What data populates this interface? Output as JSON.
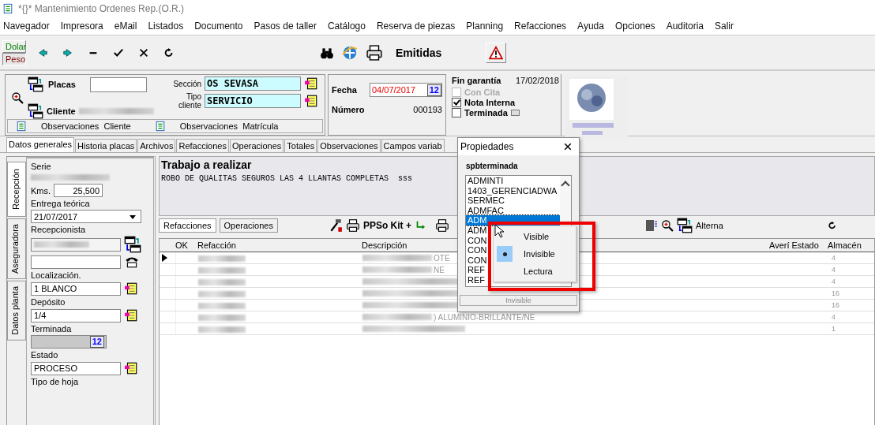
{
  "window": {
    "title": "*{}* Mantenimiento Ordenes Rep.(O.R.)"
  },
  "menu": [
    "Navegador",
    "Impresora",
    "eMail",
    "Listados",
    "Documento",
    "Pasos de taller",
    "Catálogo",
    "Reserva de piezas",
    "Planning",
    "Refacciones",
    "Ayuda",
    "Opciones",
    "Auditoria",
    "Salir"
  ],
  "toolbar": {
    "currency": [
      {
        "label": "Dolar",
        "selected": false,
        "color": "#008000"
      },
      {
        "label": "Peso",
        "selected": true,
        "color": "#800000"
      }
    ],
    "view_label": "Emitidas"
  },
  "vehicle": {
    "plates_label": "Placas",
    "section_label": "Sección",
    "section_value": "OS SEVASA",
    "client_type_label": "Tipo cliente",
    "client_type_value": "SERVICIO",
    "client_label": "Cliente",
    "notes_buttons": [
      "Observaciones  Cliente",
      "Observaciones  Matrícula"
    ]
  },
  "order": {
    "date_label": "Fecha",
    "date_value": "04/07/2017",
    "calendar_label": "12",
    "number_label": "Número",
    "number_value": "000193"
  },
  "warranty": {
    "label": "Fin garantía",
    "date": "17/02/2018",
    "checks": [
      {
        "label": "Con Cita",
        "checked": false,
        "disabled": true
      },
      {
        "label": "Nota Interna",
        "checked": true,
        "disabled": false
      },
      {
        "label": "Terminada",
        "checked": false,
        "disabled": false
      }
    ]
  },
  "tabs": [
    {
      "label": "Datos generales",
      "selected": true
    },
    {
      "label": "Historia placas",
      "selected": false
    },
    {
      "label": "Archivos",
      "selected": false
    },
    {
      "label": "Refacciones",
      "selected": false
    },
    {
      "label": "Operaciones",
      "selected": false
    },
    {
      "label": "Totales",
      "selected": false
    },
    {
      "label": "Observaciones",
      "selected": false
    },
    {
      "label": "Campos variab",
      "selected": false
    }
  ],
  "side_tabs": [
    {
      "label": "Recepción",
      "selected": true
    },
    {
      "label": "Aseguradora",
      "selected": false
    },
    {
      "label": "Datos planta",
      "selected": false
    }
  ],
  "reception_fields": [
    {
      "label": "Serie",
      "kind": "blurred"
    },
    {
      "label": "Kms.",
      "kind": "inline",
      "value": "25,500"
    },
    {
      "label": "Entrega teórica",
      "kind": "dropdown",
      "value": "21/07/2017"
    },
    {
      "label": "Recepcionista",
      "kind": "person"
    },
    {
      "label": "Localización.",
      "kind": "lookup",
      "value": "1 BLANCO"
    },
    {
      "label": "Depósito",
      "kind": "lookup",
      "value": "1/4"
    },
    {
      "label": "Terminada",
      "kind": "date",
      "calendar_label": "12"
    },
    {
      "label": "Estado",
      "kind": "lookup",
      "value": "PROCESO"
    },
    {
      "label": "Tipo de hoja",
      "kind": "label"
    }
  ],
  "work": {
    "title": "Trabajo a realizar",
    "text": "ROBO DE QUALITAS SEGUROS LAS 4 LLANTAS COMPLETAS  sss"
  },
  "parts": {
    "tabs": [
      {
        "label": "Refacciones",
        "selected": true
      },
      {
        "label": "Operaciones",
        "selected": false
      }
    ],
    "kit_label": "PPSo Kit +",
    "alterna_label": "Alterna",
    "columns": [
      "OK",
      "Refacción",
      "Descripción",
      "Averí Estado",
      "Almacén"
    ],
    "rows": [
      {
        "current": true,
        "description": "OTE",
        "almacen": "4"
      },
      {
        "current": false,
        "description": "NE",
        "almacen": "4"
      },
      {
        "current": false,
        "almacen": "4"
      },
      {
        "current": false,
        "almacen": "16"
      },
      {
        "current": false,
        "almacen": "16"
      },
      {
        "current": false,
        "description": ") ALUMINIO-BRILLANTE/NE",
        "almacen": "4"
      },
      {
        "current": false,
        "almacen": "1"
      }
    ]
  },
  "properties_dialog": {
    "title": "Propiedades",
    "field": "spbterminada",
    "users": [
      {
        "label": "ADMINTI",
        "selected": false
      },
      {
        "label": "1403_GERENCIADWA",
        "selected": false
      },
      {
        "label": "SERMEC",
        "selected": false
      },
      {
        "label": "ADMFAC",
        "selected": false
      },
      {
        "label": "ADM",
        "selected": true
      },
      {
        "label": "ADM",
        "selected": false
      },
      {
        "label": "CON",
        "selected": false
      },
      {
        "label": "CON",
        "selected": false
      },
      {
        "label": "CON",
        "selected": false
      },
      {
        "label": "REF",
        "selected": false
      },
      {
        "label": "REF",
        "selected": false
      }
    ],
    "status": "Invisible"
  },
  "context_menu": [
    {
      "label": "Visible",
      "selected": false
    },
    {
      "label": "Invisible",
      "selected": true
    },
    {
      "label": "Lectura",
      "selected": false
    }
  ]
}
